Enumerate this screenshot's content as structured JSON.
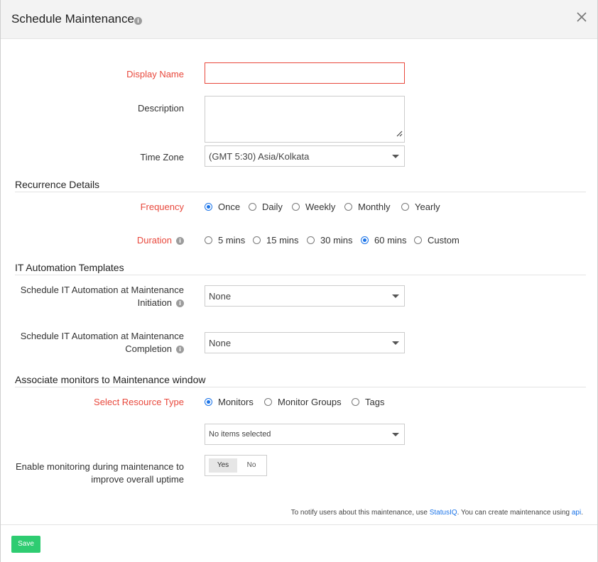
{
  "dialog": {
    "title": "Schedule Maintenance"
  },
  "form": {
    "display_name": {
      "label": "Display Name",
      "value": ""
    },
    "description": {
      "label": "Description",
      "value": ""
    },
    "time_zone": {
      "label": "Time Zone",
      "value": "(GMT 5:30) Asia/Kolkata"
    }
  },
  "recurrence": {
    "title": "Recurrence Details",
    "frequency": {
      "label": "Frequency",
      "options": [
        "Once",
        "Daily",
        "Weekly",
        "Monthly",
        "Yearly"
      ],
      "selected": "Once"
    },
    "duration": {
      "label": "Duration",
      "options": [
        "5 mins",
        "15 mins",
        "30 mins",
        "60 mins",
        "Custom"
      ],
      "selected": "60 mins"
    }
  },
  "automation": {
    "title": "IT Automation Templates",
    "initiation": {
      "label_line1": "Schedule IT Automation at Maintenance",
      "label_line2": "Initiation",
      "value": "None"
    },
    "completion": {
      "label_line1": "Schedule IT Automation at Maintenance",
      "label_line2": "Completion",
      "value": "None"
    }
  },
  "monitors": {
    "title": "Associate monitors to Maintenance window",
    "resource_type": {
      "label": "Select Resource Type",
      "options": [
        "Monitors",
        "Monitor Groups",
        "Tags"
      ],
      "selected": "Monitors"
    },
    "items": {
      "value": "No items selected"
    },
    "enable_monitoring": {
      "label_line1": "Enable monitoring during maintenance to",
      "label_line2": "improve overall uptime",
      "yes": "Yes",
      "no": "No",
      "selected": "Yes"
    }
  },
  "note": {
    "prefix": "To notify users about this maintenance, use ",
    "statusiq": "StatusIQ",
    "middle": ". You can create maintenance using ",
    "api": "api",
    "suffix": "."
  },
  "footer": {
    "save_label": "Save"
  },
  "colors": {
    "required": "#e8483c",
    "accent": "#1a73e8",
    "save": "#2ecc71"
  }
}
